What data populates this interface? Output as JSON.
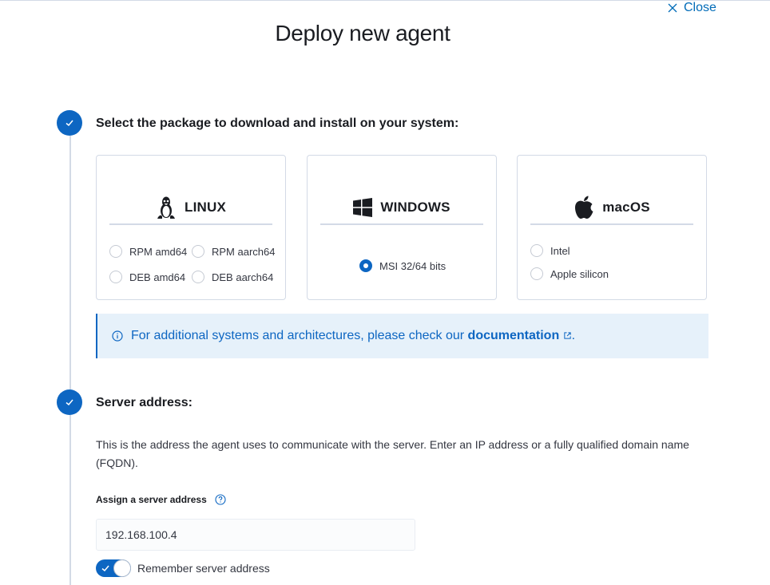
{
  "dialog": {
    "close_label": "Close",
    "title": "Deploy new agent"
  },
  "step1": {
    "title": "Select the package to download and install on your system:",
    "cards": {
      "linux": {
        "label": "LINUX",
        "options": [
          "RPM amd64",
          "RPM aarch64",
          "DEB amd64",
          "DEB aarch64"
        ]
      },
      "windows": {
        "label": "WINDOWS",
        "options": [
          "MSI 32/64 bits"
        ],
        "selected": "MSI 32/64 bits"
      },
      "macos": {
        "label": "macOS",
        "options": [
          "Intel",
          "Apple silicon"
        ]
      }
    },
    "callout": {
      "text_before": "For additional systems and architectures, please check our ",
      "link": "documentation",
      "text_after": "."
    }
  },
  "step2": {
    "title": "Server address:",
    "description": "This is the address the agent uses to communicate with the server. Enter an IP address or a fully qualified domain name (FQDN).",
    "field_label": "Assign a server address",
    "field_value": "192.168.100.4",
    "remember_label": "Remember server address",
    "remember_on": true
  },
  "colors": {
    "accent": "#0d66c2",
    "callout_bg": "#e6f1fa",
    "border": "#d3dae6"
  },
  "icons": [
    "close-icon",
    "check-icon",
    "linux-icon",
    "windows-icon",
    "apple-icon",
    "info-icon",
    "external-link-icon",
    "help-icon"
  ]
}
